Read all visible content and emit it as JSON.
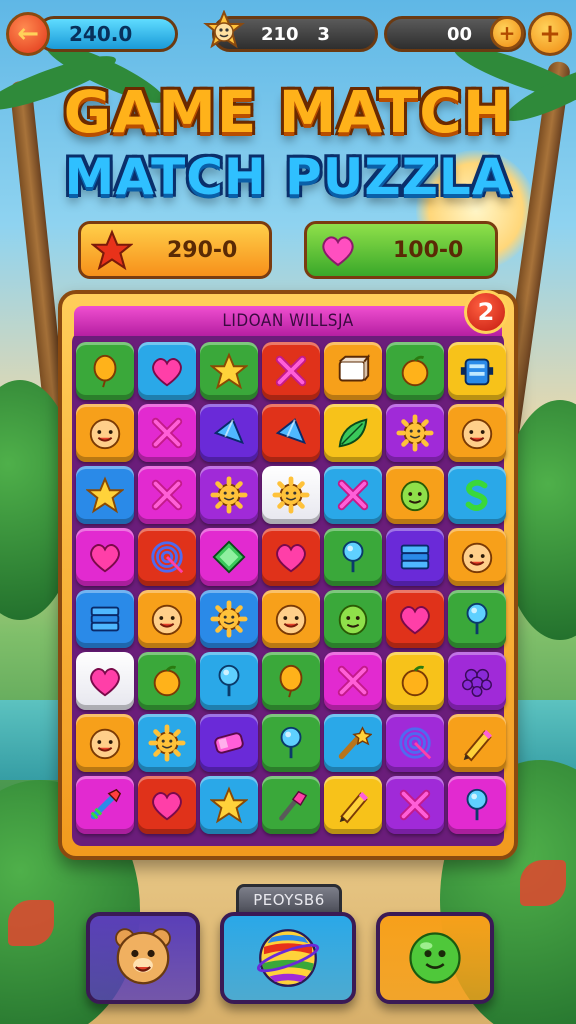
{
  "topbar": {
    "left_value": "240.0",
    "mid_value": "210   3",
    "right_value": "00"
  },
  "title": {
    "line1": "GAME MATCH",
    "line2": "MATCH PUZZLA"
  },
  "scores": {
    "star_value": "290-0",
    "heart_value": "100-0"
  },
  "board": {
    "header": "LIDOAN WILLSJA",
    "level": "2",
    "grid": [
      [
        "balloon",
        "heart",
        "star",
        "x",
        "cube",
        "orange",
        "robot"
      ],
      [
        "face",
        "x",
        "gem",
        "gem",
        "leaf",
        "gear",
        "face"
      ],
      [
        "star",
        "x",
        "gear",
        "gear",
        "x",
        "eggface",
        "s"
      ],
      [
        "heart",
        "swirl",
        "diamond",
        "heart",
        "pin",
        "stack",
        "face"
      ],
      [
        "stack",
        "face",
        "gear",
        "face",
        "eggface",
        "heart",
        "pin"
      ],
      [
        "heart",
        "orange",
        "pin",
        "balloon",
        "x",
        "orange",
        "grape"
      ],
      [
        "face",
        "gear",
        "candy",
        "pin",
        "wand",
        "swirl",
        "pencil"
      ],
      [
        "arrow",
        "heart",
        "star",
        "dart",
        "pencil",
        "x",
        "pin"
      ]
    ],
    "colors": [
      [
        "#3aa83a",
        "#2aa8e8",
        "#3aa83a",
        "#e0321a",
        "#f7a01a",
        "#3aa83a",
        "#f7c21a"
      ],
      [
        "#f7a01a",
        "#e22ad0",
        "#6a2ad8",
        "#e0321a",
        "#f7c21a",
        "#a02ad8",
        "#f7a01a"
      ],
      [
        "#2a8ae8",
        "#e22ad0",
        "#a02ad8",
        "#ffffff",
        "#2aa8e8",
        "#f7a01a",
        "#2aa8e8"
      ],
      [
        "#e22ad0",
        "#e0321a",
        "#e22ad0",
        "#e0321a",
        "#3aa83a",
        "#6a2ad8",
        "#f7a01a"
      ],
      [
        "#2a8ae8",
        "#f7a01a",
        "#2a8ae8",
        "#f7a01a",
        "#3aa83a",
        "#e0321a",
        "#3aa83a"
      ],
      [
        "#ffffff",
        "#3aa83a",
        "#2aa8e8",
        "#3aa83a",
        "#e22ad0",
        "#f7c21a",
        "#a02ad8"
      ],
      [
        "#f7a01a",
        "#2aa8e8",
        "#6a2ad8",
        "#3aa83a",
        "#2aa8e8",
        "#a02ad8",
        "#f7a01a"
      ],
      [
        "#e22ad0",
        "#e0321a",
        "#2aa8e8",
        "#3aa83a",
        "#f7c21a",
        "#a02ad8",
        "#e22ad0"
      ]
    ]
  },
  "boosters": {
    "label": "PEOYSB6",
    "items": [
      {
        "icon": "bear-icon",
        "color": "#5a3fb8"
      },
      {
        "icon": "beach-ball-icon",
        "color": "#2aa8e8"
      },
      {
        "icon": "green-blob-icon",
        "color": "#f7a01a"
      }
    ]
  },
  "colors": {
    "accent_orange": "#f7a01a",
    "title_gold": "#ffb21a",
    "title_blue": "#2fc0ff",
    "board_purple": "#6a1d7a"
  }
}
